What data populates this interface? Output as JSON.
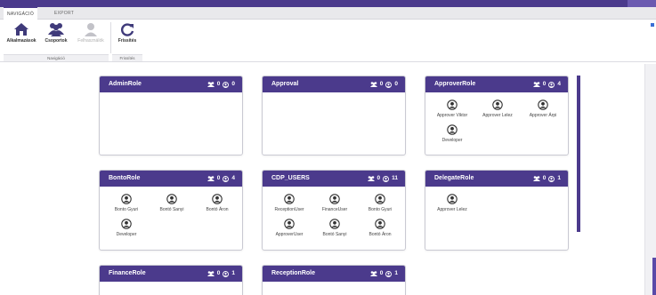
{
  "tabs": [
    {
      "label": "NAVIGÁCIÓ",
      "active": true
    },
    {
      "label": "EXPORT",
      "active": false
    }
  ],
  "ribbon": {
    "buttons": [
      {
        "label": "Alkalmazások",
        "icon": "home-icon",
        "disabled": false
      },
      {
        "label": "Csoportok",
        "icon": "group-icon",
        "disabled": false
      },
      {
        "label": "Felhasználók",
        "icon": "user-icon",
        "disabled": true
      },
      {
        "label": "Frissítés",
        "icon": "refresh-icon",
        "disabled": false
      }
    ],
    "groups": [
      {
        "label": "Navigáció"
      },
      {
        "label": "Frissítés"
      }
    ]
  },
  "colors": {
    "brand": "#4b3a8c",
    "card_header": "#4b3a8c"
  },
  "cards": [
    {
      "title": "AdminRole",
      "groups": "0",
      "users": "0",
      "members": []
    },
    {
      "title": "Approval",
      "groups": "0",
      "users": "0",
      "members": []
    },
    {
      "title": "ApproverRole",
      "groups": "0",
      "users": "4",
      "members": [
        "Approver Viktor",
        "Approver Lelez",
        "Approver Árpi",
        "Developer"
      ]
    },
    {
      "title": "BontoRole",
      "groups": "0",
      "users": "4",
      "members": [
        "Bonto Gyuri",
        "Bontó Sanyi",
        "Bontó Áron",
        "Developer"
      ]
    },
    {
      "title": "CDP_USERS",
      "groups": "0",
      "users": "11",
      "members": [
        "ReceptionUser",
        "FinanceUser",
        "Bonto Gyuri",
        "ApproverUser",
        "Bontó Sanyi",
        "Bontó Áron"
      ]
    },
    {
      "title": "DelegateRole",
      "groups": "0",
      "users": "1",
      "members": [
        "Approver Lelez"
      ]
    },
    {
      "title": "FinanceRole",
      "groups": "0",
      "users": "1",
      "members": []
    },
    {
      "title": "ReceptionRole",
      "groups": "0",
      "users": "1",
      "members": []
    }
  ]
}
